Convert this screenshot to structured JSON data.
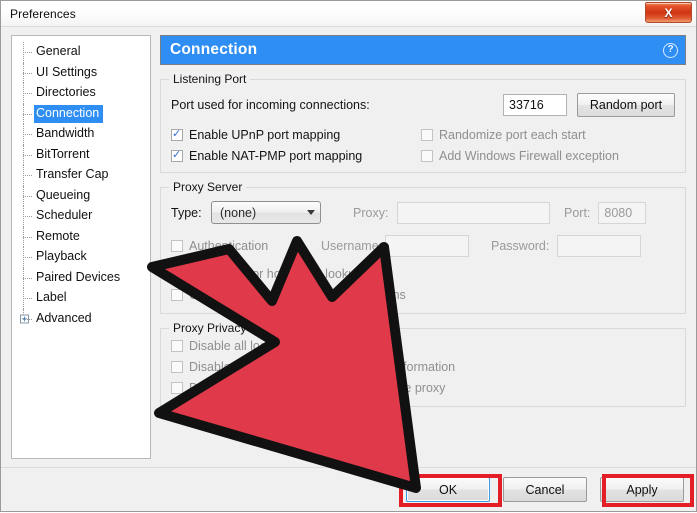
{
  "window": {
    "title": "Preferences",
    "close_label": "X",
    "accent_blue": "#2f8ef4",
    "annotation_red": "#e31e26"
  },
  "sidebar": {
    "items": [
      {
        "label": "General",
        "selected": false,
        "expandable": false
      },
      {
        "label": "UI Settings",
        "selected": false,
        "expandable": false
      },
      {
        "label": "Directories",
        "selected": false,
        "expandable": false
      },
      {
        "label": "Connection",
        "selected": true,
        "expandable": false
      },
      {
        "label": "Bandwidth",
        "selected": false,
        "expandable": false
      },
      {
        "label": "BitTorrent",
        "selected": false,
        "expandable": false
      },
      {
        "label": "Transfer Cap",
        "selected": false,
        "expandable": false
      },
      {
        "label": "Queueing",
        "selected": false,
        "expandable": false
      },
      {
        "label": "Scheduler",
        "selected": false,
        "expandable": false
      },
      {
        "label": "Remote",
        "selected": false,
        "expandable": false
      },
      {
        "label": "Playback",
        "selected": false,
        "expandable": false
      },
      {
        "label": "Paired Devices",
        "selected": false,
        "expandable": false
      },
      {
        "label": "Label",
        "selected": false,
        "expandable": false
      },
      {
        "label": "Advanced",
        "selected": false,
        "expandable": true,
        "expander": "+"
      }
    ]
  },
  "page": {
    "title": "Connection",
    "help_icon": "question-mark-icon",
    "help_label": "?"
  },
  "listening_port": {
    "legend": "Listening Port",
    "port_label": "Port used for incoming connections:",
    "port_value": "33716",
    "random_port_button": "Random port",
    "checkboxes": [
      {
        "label": "Enable UPnP port mapping",
        "checked": true,
        "enabled": true
      },
      {
        "label": "Randomize port each start",
        "checked": false,
        "enabled": true
      },
      {
        "label": "Enable NAT-PMP port mapping",
        "checked": true,
        "enabled": true
      },
      {
        "label": "Add Windows Firewall exception",
        "checked": false,
        "enabled": true
      }
    ]
  },
  "proxy_server": {
    "legend": "Proxy Server",
    "type_label": "Type:",
    "type_value": "(none)",
    "proxy_label": "Proxy:",
    "proxy_value": "",
    "port_label": "Port:",
    "port_value": "8080",
    "auth_label": "Authentication",
    "auth_checked": false,
    "username_label": "Username:",
    "username_value": "",
    "password_label": "Password:",
    "password_value": "",
    "options": [
      {
        "label": "Use proxy for hostname lookups",
        "checked": false
      },
      {
        "label": "Use proxy for peer-to-peer connections",
        "checked": false
      }
    ]
  },
  "proxy_privacy": {
    "legend": "Proxy Privacy",
    "options": [
      {
        "label": "Disable all local DNS lookups",
        "checked": false
      },
      {
        "label": "Disable features that leak identifying information",
        "checked": false
      },
      {
        "label": "Disable connections unsupported by the proxy",
        "checked": false
      }
    ]
  },
  "footer": {
    "ok_label": "OK",
    "cancel_label": "Cancel",
    "apply_label": "Apply"
  },
  "annotation": {
    "arrow": "red-cursor-arrow",
    "arrow_fill": "#e03a4a",
    "arrow_stroke": "#000000",
    "highlight_targets": [
      "OK",
      "Apply"
    ]
  }
}
